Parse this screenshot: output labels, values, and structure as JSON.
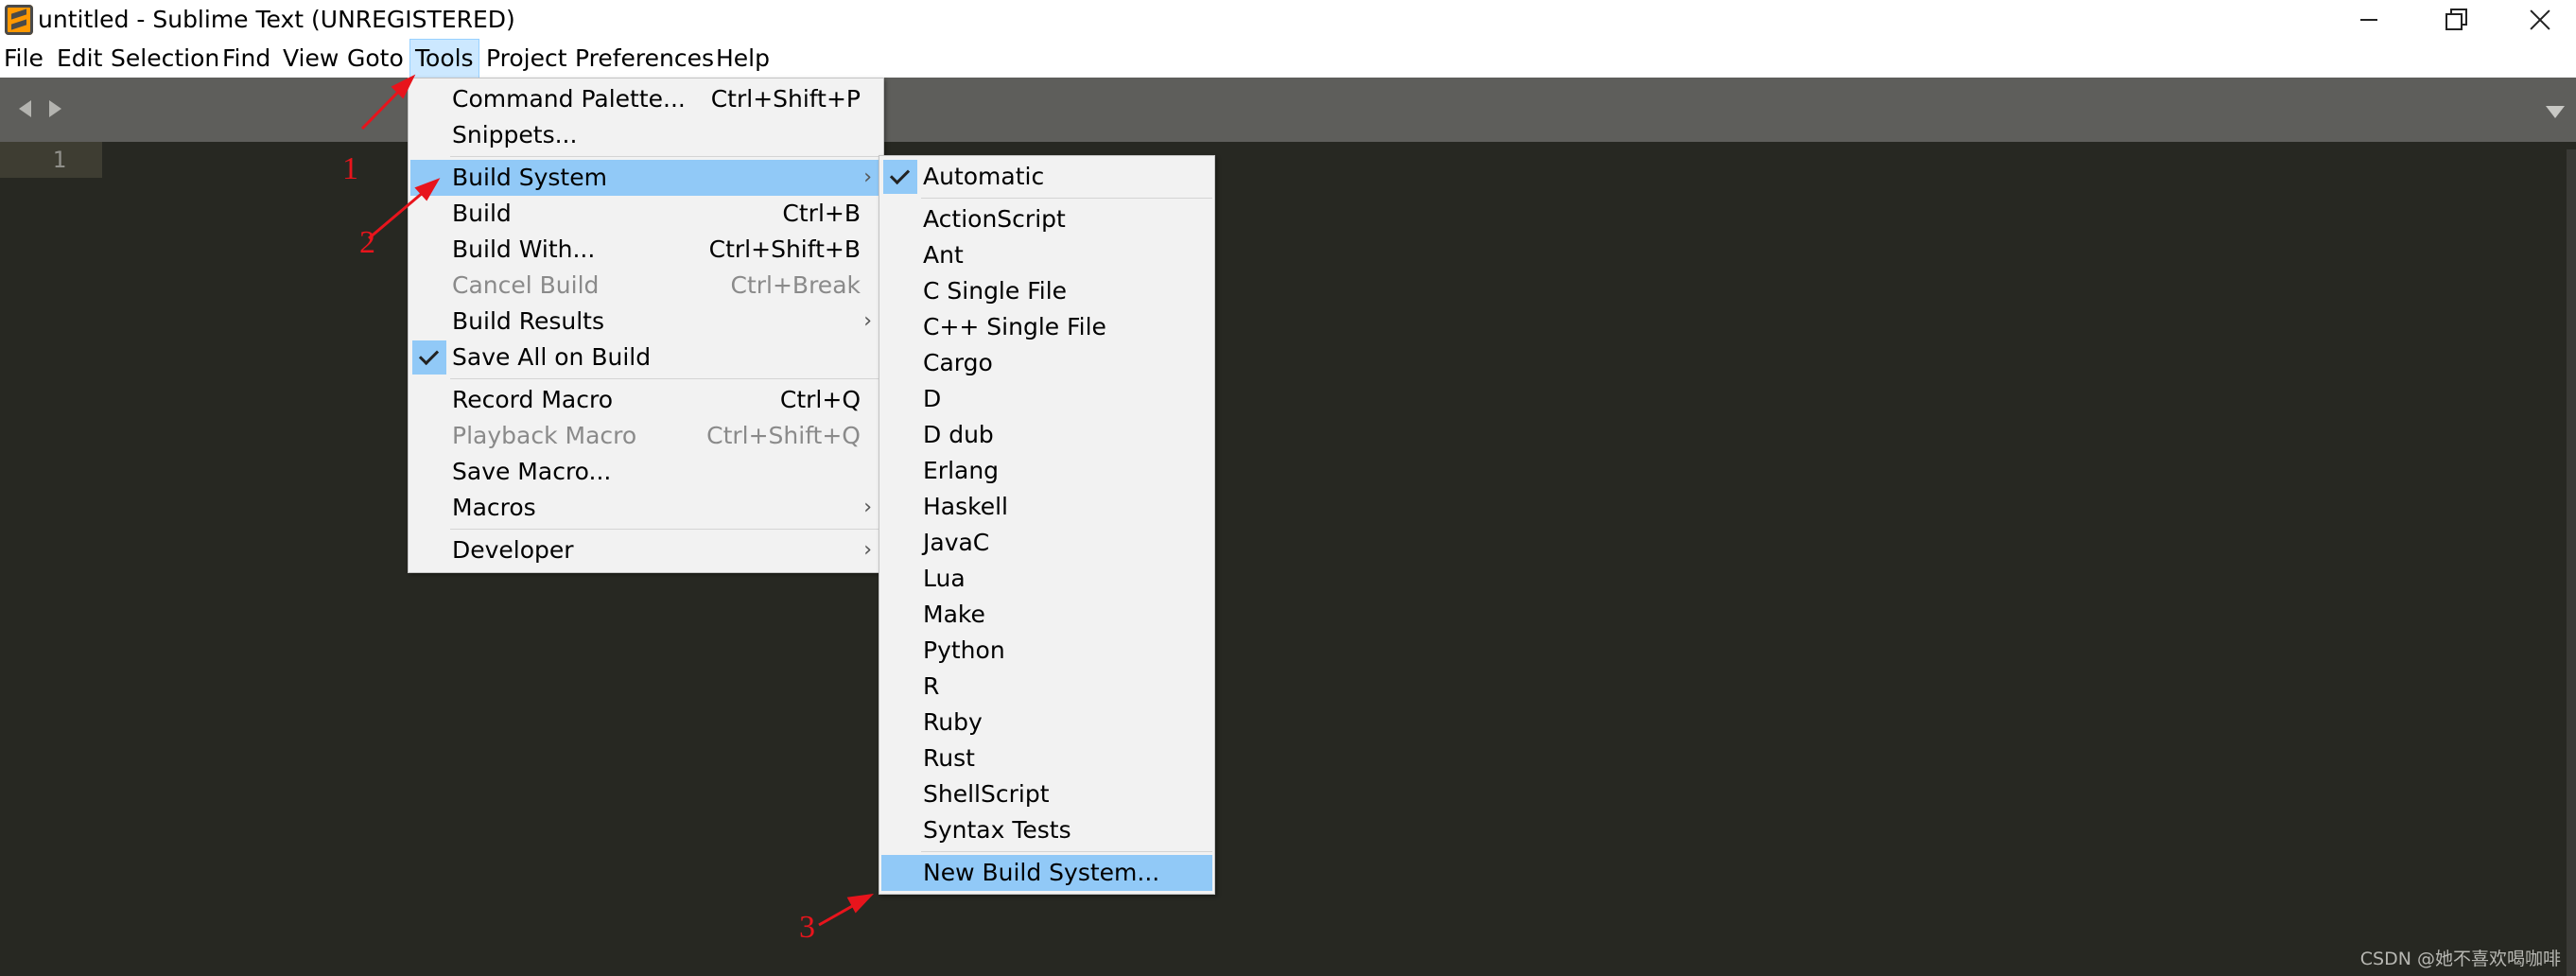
{
  "window": {
    "title": "untitled - Sublime Text (UNREGISTERED)"
  },
  "menubar": [
    {
      "label": "File"
    },
    {
      "label": "Edit"
    },
    {
      "label": "Selection"
    },
    {
      "label": "Find"
    },
    {
      "label": "View"
    },
    {
      "label": "Goto"
    },
    {
      "label": "Tools"
    },
    {
      "label": "Project"
    },
    {
      "label": "Preferences"
    },
    {
      "label": "Help"
    }
  ],
  "active_menu": "Tools",
  "editor": {
    "line_numbers": [
      "1"
    ]
  },
  "tools_menu": {
    "items": [
      {
        "label": "Command Palette...",
        "shortcut": "Ctrl+Shift+P"
      },
      {
        "label": "Snippets..."
      },
      {
        "label": "Build System",
        "submenu": true,
        "highlighted": true
      },
      {
        "label": "Build",
        "shortcut": "Ctrl+B"
      },
      {
        "label": "Build With...",
        "shortcut": "Ctrl+Shift+B"
      },
      {
        "label": "Cancel Build",
        "shortcut": "Ctrl+Break",
        "disabled": true
      },
      {
        "label": "Build Results",
        "submenu": true
      },
      {
        "label": "Save All on Build",
        "checked": true
      },
      {
        "label": "Record Macro",
        "shortcut": "Ctrl+Q"
      },
      {
        "label": "Playback Macro",
        "shortcut": "Ctrl+Shift+Q",
        "disabled": true
      },
      {
        "label": "Save Macro..."
      },
      {
        "label": "Macros",
        "submenu": true
      },
      {
        "label": "Developer",
        "submenu": true
      }
    ]
  },
  "build_system_menu": {
    "items": [
      {
        "label": "Automatic",
        "checked": true
      },
      {
        "label": "ActionScript"
      },
      {
        "label": "Ant"
      },
      {
        "label": "C Single File"
      },
      {
        "label": "C++ Single File"
      },
      {
        "label": "Cargo"
      },
      {
        "label": "D"
      },
      {
        "label": "D dub"
      },
      {
        "label": "Erlang"
      },
      {
        "label": "Haskell"
      },
      {
        "label": "JavaC"
      },
      {
        "label": "Lua"
      },
      {
        "label": "Make"
      },
      {
        "label": "Python"
      },
      {
        "label": "R"
      },
      {
        "label": "Ruby"
      },
      {
        "label": "Rust"
      },
      {
        "label": "ShellScript"
      },
      {
        "label": "Syntax Tests"
      },
      {
        "label": "New Build System...",
        "highlighted": true
      }
    ]
  },
  "annotations": {
    "step1": "1",
    "step2": "2",
    "step3": "3",
    "color": "#e8141c"
  },
  "watermark": "CSDN @她不喜欢喝咖啡",
  "colors": {
    "editor_bg": "#272822",
    "tabbar_bg": "#5e5e5b",
    "menu_bg": "#f2f2f2",
    "menu_highlight": "#91c9f7"
  }
}
